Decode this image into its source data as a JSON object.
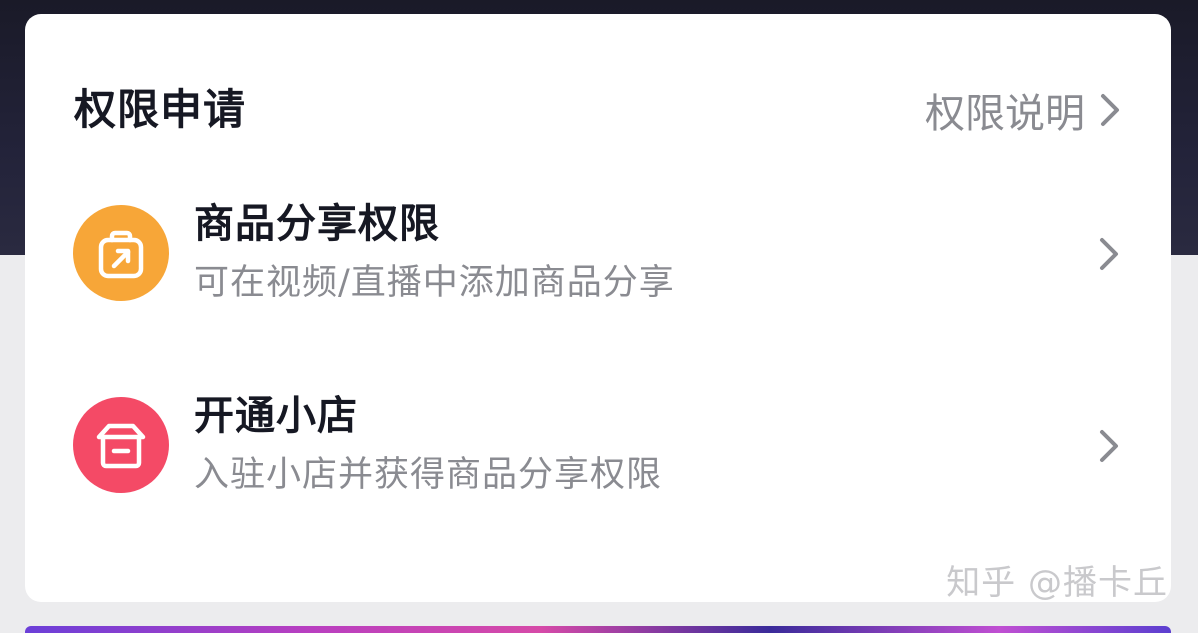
{
  "header": {
    "title": "权限申请",
    "link_label": "权限说明"
  },
  "permissions": [
    {
      "title": "商品分享权限",
      "subtitle": "可在视频/直播中添加商品分享",
      "icon": "share-external-icon",
      "icon_color": "#f7a638"
    },
    {
      "title": "开通小店",
      "subtitle": "入驻小店并获得商品分享权限",
      "icon": "storefront-icon",
      "icon_color": "#f44a66"
    }
  ],
  "watermark": "知乎 @播卡丘",
  "colors": {
    "title": "#161823",
    "secondary": "#8a8b91"
  }
}
